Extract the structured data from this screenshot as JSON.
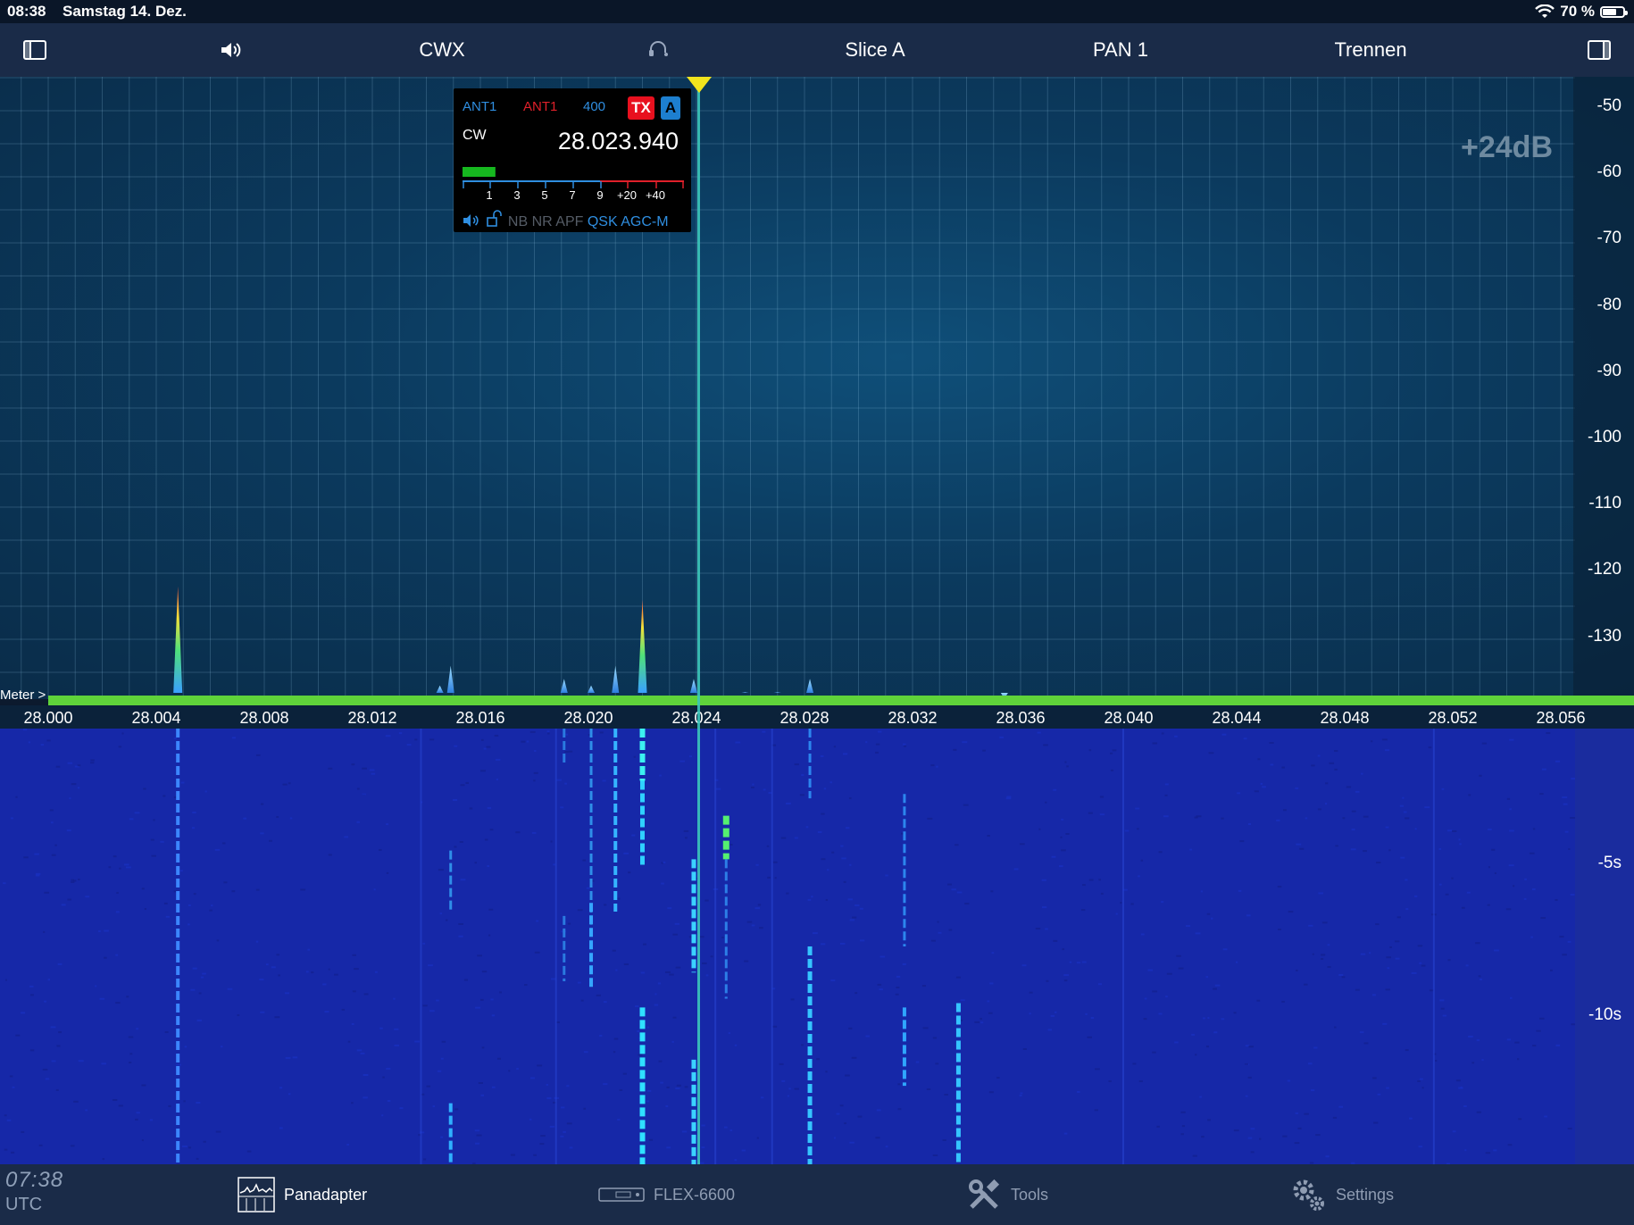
{
  "status_bar": {
    "time": "08:38",
    "date": "Samstag 14. Dez.",
    "battery": "70 %",
    "battery_level": 0.7
  },
  "toolbar": {
    "items": [
      {
        "label": "CWX"
      },
      {
        "label": "Slice A"
      },
      {
        "label": "PAN 1"
      },
      {
        "label": "Trennen"
      }
    ],
    "icons": [
      "sidebar-left-icon",
      "speaker-icon",
      "headset-icon",
      "sidebar-right-icon"
    ]
  },
  "panadapter": {
    "gain": "+24dB",
    "db_labels": [
      "-50",
      "-60",
      "-70",
      "-80",
      "-90",
      "-100",
      "-110",
      "-120",
      "-130"
    ],
    "freq_labels": [
      "28.000",
      "28.004",
      "28.008",
      "28.012",
      "28.016",
      "28.020",
      "28.024",
      "28.028",
      "28.032",
      "28.036",
      "28.040",
      "28.044",
      "28.048",
      "28.052",
      "28.056"
    ],
    "meter_label": "Meter >",
    "peaks": [
      {
        "freq": 28.0048,
        "dbm": -122,
        "strong": true
      },
      {
        "freq": 28.0145,
        "dbm": -137
      },
      {
        "freq": 28.0149,
        "dbm": -134
      },
      {
        "freq": 28.0191,
        "dbm": -136
      },
      {
        "freq": 28.0201,
        "dbm": -137
      },
      {
        "freq": 28.021,
        "dbm": -134
      },
      {
        "freq": 28.022,
        "dbm": -124,
        "strong": true
      },
      {
        "freq": 28.0239,
        "dbm": -136
      },
      {
        "freq": 28.0258,
        "dbm": -138
      },
      {
        "freq": 28.027,
        "dbm": -138
      },
      {
        "freq": 28.0282,
        "dbm": -136
      },
      {
        "freq": 28.0354,
        "dbm": -139
      }
    ]
  },
  "slice": {
    "rx_ant": "ANT1",
    "tx_ant": "ANT1",
    "filter": "400",
    "tx_badge": "TX",
    "slice_badge": "A",
    "mode": "CW",
    "frequency": "28.023.940",
    "signal_level": 0.11,
    "scale": [
      "1",
      "3",
      "5",
      "7",
      "9",
      "+20",
      "+40"
    ],
    "flags": {
      "nb": "NB",
      "nr": "NR",
      "apf": "APF",
      "qsk": "QSK",
      "agc": "AGC-M"
    }
  },
  "waterfall": {
    "time_labels": [
      "-5s",
      "-10s"
    ],
    "lines": [
      {
        "freq": 28.0048,
        "y0": 0,
        "y1": 1,
        "color": "#3c86ff",
        "w": 4
      },
      {
        "freq": 28.0149,
        "y0": 0.28,
        "y1": 0.42,
        "color": "#2f8ee8",
        "w": 3
      },
      {
        "freq": 28.0149,
        "y0": 0.86,
        "y1": 1,
        "color": "#2fb0ff",
        "w": 4
      },
      {
        "freq": 28.0191,
        "y0": 0,
        "y1": 0.08,
        "color": "#2a7ae0",
        "w": 3
      },
      {
        "freq": 28.0191,
        "y0": 0.43,
        "y1": 0.58,
        "color": "#2a7ae0",
        "w": 3
      },
      {
        "freq": 28.0201,
        "y0": 0,
        "y1": 0.45,
        "color": "#2f8ee8",
        "w": 3
      },
      {
        "freq": 28.0201,
        "y0": 0.4,
        "y1": 0.6,
        "color": "#35a6ff",
        "w": 4
      },
      {
        "freq": 28.021,
        "y0": 0,
        "y1": 0.42,
        "color": "#35b4ff",
        "w": 4
      },
      {
        "freq": 28.022,
        "y0": 0,
        "y1": 0.12,
        "color": "#3cf0f0",
        "w": 6
      },
      {
        "freq": 28.022,
        "y0": 0.12,
        "y1": 0.32,
        "color": "#2fd0ff",
        "w": 5
      },
      {
        "freq": 28.022,
        "y0": 0.64,
        "y1": 1,
        "color": "#2fe0ff",
        "w": 6
      },
      {
        "freq": 28.0239,
        "y0": 0.3,
        "y1": 0.56,
        "color": "#3bd2ff",
        "w": 5
      },
      {
        "freq": 28.0239,
        "y0": 0.76,
        "y1": 1,
        "color": "#3bd2ff",
        "w": 5
      },
      {
        "freq": 28.0251,
        "y0": 0.2,
        "y1": 0.3,
        "color": "#54f070",
        "w": 7
      },
      {
        "freq": 28.0251,
        "y0": 0.3,
        "y1": 0.62,
        "color": "#2c7ee6",
        "w": 3
      },
      {
        "freq": 28.0282,
        "y0": 0,
        "y1": 0.16,
        "color": "#2c86ee",
        "w": 3
      },
      {
        "freq": 28.0282,
        "y0": 0.5,
        "y1": 1,
        "color": "#35c4ff",
        "w": 5
      },
      {
        "freq": 28.0317,
        "y0": 0.15,
        "y1": 0.5,
        "color": "#2c86ee",
        "w": 3
      },
      {
        "freq": 28.0317,
        "y0": 0.64,
        "y1": 0.82,
        "color": "#2fa6ff",
        "w": 4
      },
      {
        "freq": 28.0337,
        "y0": 0.63,
        "y1": 1,
        "color": "#35c4ff",
        "w": 5
      }
    ]
  },
  "tabbar": {
    "clock_time": "07:38",
    "clock_zone": "UTC",
    "tabs": [
      {
        "label": "Panadapter",
        "active": true
      },
      {
        "label": "FLEX-6600"
      },
      {
        "label": "Tools"
      },
      {
        "label": "Settings"
      }
    ]
  },
  "colors": {
    "toolbar_bg": "#1a2b48",
    "tx_red": "#e8101e",
    "slice_blue": "#1d7fcf",
    "meter_green": "#5fd33a",
    "tune_yellow": "#f2e41d"
  }
}
